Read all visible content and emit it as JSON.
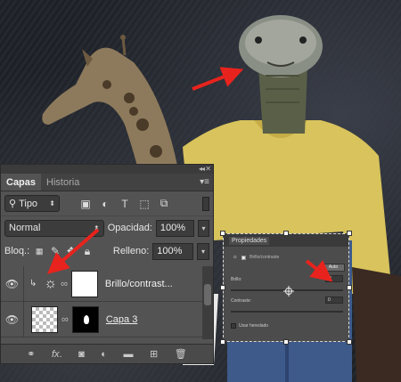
{
  "layers_panel": {
    "tabs": [
      {
        "label": "Capas",
        "active": true
      },
      {
        "label": "Historia",
        "active": false
      }
    ],
    "filter": {
      "value": "Tipo"
    },
    "blend_mode": {
      "value": "Normal"
    },
    "opacity": {
      "label": "Opacidad:",
      "value": "100%"
    },
    "lock": {
      "label": "Bloq.:"
    },
    "fill": {
      "label": "Relleno:",
      "value": "100%"
    },
    "layers": [
      {
        "name": "Brillo/contrast...",
        "type": "adjustment",
        "visible": true
      },
      {
        "name": "Capa 3",
        "type": "pixel-with-mask",
        "visible": true
      }
    ],
    "bottom_icons": [
      "link-icon",
      "fx-icon",
      "mask-icon",
      "adjustment-icon",
      "group-icon",
      "new-layer-icon",
      "trash-icon"
    ]
  },
  "properties_panel": {
    "title": "Propiedades",
    "subtitle": "Brillo/contraste",
    "auto_label": "Auto",
    "brightness": {
      "label": "Brillo:",
      "value": "-1"
    },
    "contrast": {
      "label": "Contraste:",
      "value": "0"
    },
    "legacy_label": "Usar heredado"
  },
  "colors": {
    "panel_bg": "#535353",
    "annotation_arrow": "#e8231d",
    "shirt": "#d8c35c"
  }
}
